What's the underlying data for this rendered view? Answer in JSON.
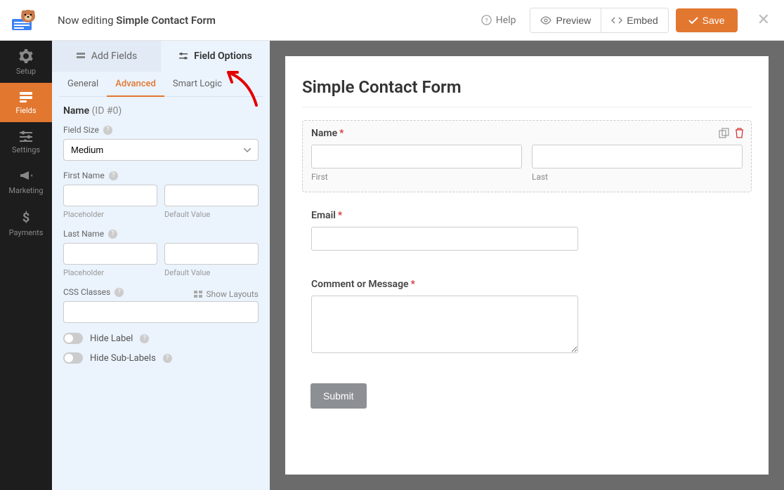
{
  "header": {
    "editing_prefix": "Now editing ",
    "form_title": "Simple Contact Form",
    "help": "Help",
    "preview": "Preview",
    "embed": "Embed",
    "save": "Save"
  },
  "nav": {
    "setup": "Setup",
    "fields": "Fields",
    "settings": "Settings",
    "marketing": "Marketing",
    "payments": "Payments"
  },
  "panel": {
    "add_fields": "Add Fields",
    "field_options": "Field Options",
    "subtabs": {
      "general": "General",
      "advanced": "Advanced",
      "smart": "Smart Logic"
    },
    "field_name": "Name",
    "field_id": "(ID #0)",
    "field_size": "Field Size",
    "field_size_value": "Medium",
    "first_name": "First Name",
    "last_name": "Last Name",
    "placeholder": "Placeholder",
    "default_value": "Default Value",
    "css_classes": "CSS Classes",
    "show_layouts": "Show Layouts",
    "hide_label": "Hide Label",
    "hide_sublabels": "Hide Sub-Labels"
  },
  "preview": {
    "title": "Simple Contact Form",
    "name_label": "Name",
    "first": "First",
    "last": "Last",
    "email_label": "Email",
    "comment_label": "Comment or Message",
    "submit": "Submit"
  }
}
